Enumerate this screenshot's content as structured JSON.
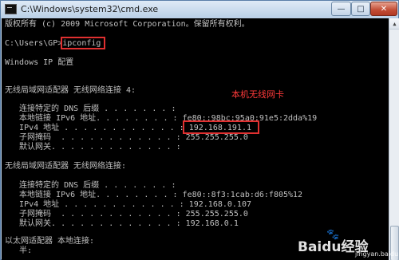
{
  "window": {
    "title": "C:\\Windows\\system32\\cmd.exe",
    "controls": {
      "minimize": "—",
      "maximize": "□",
      "close": "✕"
    },
    "icon": "cmd-icon"
  },
  "console": {
    "lines": [
      "版权所有 (c) 2009 Microsoft Corporation。保留所有权利。",
      "C:\\Users\\GP>ipconfig",
      "Windows IP 配置",
      "无线局域网适配器 无线网络连接 4:",
      "   连接特定的 DNS 后缀 . . . . . . . :",
      "   本地链接 IPv6 地址. . . . . . . . : fe80::98bc:95a0:91e5:2dda%19",
      "   IPv4 地址 . . . . . . . . . . . . : 192.168.191.1",
      "   子网掩码  . . . . . . . . . . . . : 255.255.255.0",
      "   默认网关. . . . . . . . . . . . . :",
      "无线局域网适配器 无线网络连接:",
      "   连接特定的 DNS 后缀 . . . . . . . :",
      "   本地链接 IPv6 地址. . . . . . . . : fe80::8f3:1cab:d6:f805%12",
      "   IPv4 地址 . . . . . . . . . . . . : 192.168.0.107",
      "   子网掩码  . . . . . . . . . . . . : 255.255.255.0",
      "   默认网关. . . . . . . . . . . . . : 192.168.0.1",
      "以太网适配器 本地连接:",
      "   半:"
    ]
  },
  "annotation": {
    "label": "本机无线网卡"
  },
  "watermark": {
    "brand": "Baidu经验",
    "sub": "jingyan.baidu.com"
  },
  "colors": {
    "console_bg": "#000000",
    "console_text": "#c0c0c0",
    "highlight": "#e03030",
    "annotation": "#ff3a3a"
  }
}
